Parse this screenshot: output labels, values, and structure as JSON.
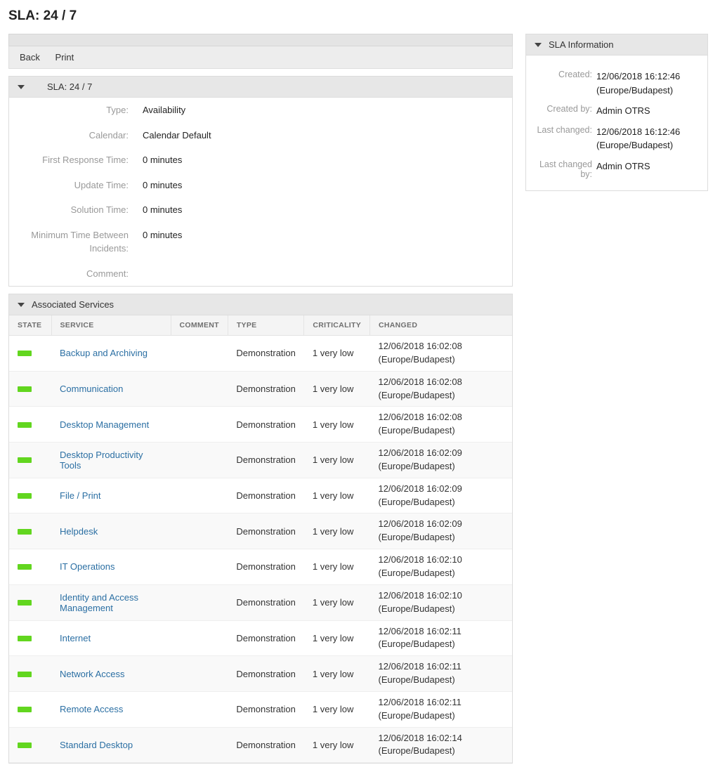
{
  "page": {
    "title": "SLA: 24 / 7"
  },
  "actions": {
    "back": "Back",
    "print": "Print"
  },
  "sla_panel": {
    "header": "SLA: 24 / 7",
    "rows": {
      "type": {
        "label": "Type:",
        "value": "Availability"
      },
      "calendar": {
        "label": "Calendar:",
        "value": "Calendar Default"
      },
      "first_response": {
        "label": "First Response Time:",
        "value": "0 minutes"
      },
      "update": {
        "label": "Update Time:",
        "value": "0 minutes"
      },
      "solution": {
        "label": "Solution Time:",
        "value": "0 minutes"
      },
      "min_between": {
        "label": "Minimum Time Between Incidents:",
        "value": "0 minutes"
      },
      "comment": {
        "label": "Comment:",
        "value": ""
      }
    }
  },
  "assoc": {
    "header": "Associated Services",
    "cols": {
      "state": "STATE",
      "service": "SERVICE",
      "comment": "COMMENT",
      "type": "TYPE",
      "criticality": "CRITICALITY",
      "changed": "CHANGED"
    },
    "rows": [
      {
        "service": "Backup and Archiving",
        "comment": "",
        "type": "Demonstration",
        "criticality": "1 very low",
        "changed_ts": "12/06/2018 16:02:08",
        "changed_tz": "(Europe/Budapest)"
      },
      {
        "service": "Communication",
        "comment": "",
        "type": "Demonstration",
        "criticality": "1 very low",
        "changed_ts": "12/06/2018 16:02:08",
        "changed_tz": "(Europe/Budapest)"
      },
      {
        "service": "Desktop Management",
        "comment": "",
        "type": "Demonstration",
        "criticality": "1 very low",
        "changed_ts": "12/06/2018 16:02:08",
        "changed_tz": "(Europe/Budapest)"
      },
      {
        "service": "Desktop Productivity Tools",
        "comment": "",
        "type": "Demonstration",
        "criticality": "1 very low",
        "changed_ts": "12/06/2018 16:02:09",
        "changed_tz": "(Europe/Budapest)"
      },
      {
        "service": "File / Print",
        "comment": "",
        "type": "Demonstration",
        "criticality": "1 very low",
        "changed_ts": "12/06/2018 16:02:09",
        "changed_tz": "(Europe/Budapest)"
      },
      {
        "service": "Helpdesk",
        "comment": "",
        "type": "Demonstration",
        "criticality": "1 very low",
        "changed_ts": "12/06/2018 16:02:09",
        "changed_tz": "(Europe/Budapest)"
      },
      {
        "service": "IT Operations",
        "comment": "",
        "type": "Demonstration",
        "criticality": "1 very low",
        "changed_ts": "12/06/2018 16:02:10",
        "changed_tz": "(Europe/Budapest)"
      },
      {
        "service": "Identity and Access Management",
        "comment": "",
        "type": "Demonstration",
        "criticality": "1 very low",
        "changed_ts": "12/06/2018 16:02:10",
        "changed_tz": "(Europe/Budapest)"
      },
      {
        "service": "Internet",
        "comment": "",
        "type": "Demonstration",
        "criticality": "1 very low",
        "changed_ts": "12/06/2018 16:02:11",
        "changed_tz": "(Europe/Budapest)"
      },
      {
        "service": "Network Access",
        "comment": "",
        "type": "Demonstration",
        "criticality": "1 very low",
        "changed_ts": "12/06/2018 16:02:11",
        "changed_tz": "(Europe/Budapest)"
      },
      {
        "service": "Remote Access",
        "comment": "",
        "type": "Demonstration",
        "criticality": "1 very low",
        "changed_ts": "12/06/2018 16:02:11",
        "changed_tz": "(Europe/Budapest)"
      },
      {
        "service": "Standard Desktop",
        "comment": "",
        "type": "Demonstration",
        "criticality": "1 very low",
        "changed_ts": "12/06/2018 16:02:14",
        "changed_tz": "(Europe/Budapest)"
      }
    ]
  },
  "info": {
    "header": "SLA Information",
    "created": {
      "label": "Created:",
      "ts": "12/06/2018 16:12:46",
      "tz": "(Europe/Budapest)"
    },
    "created_by": {
      "label": "Created by:",
      "value": "Admin OTRS"
    },
    "last_changed": {
      "label": "Last changed:",
      "ts": "12/06/2018 16:12:46",
      "tz": "(Europe/Budapest)"
    },
    "last_changed_by": {
      "label": "Last changed by:",
      "value": "Admin OTRS"
    }
  }
}
